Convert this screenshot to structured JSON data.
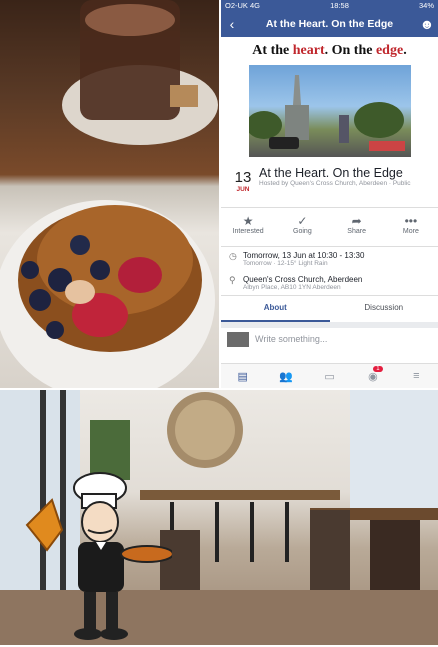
{
  "status": {
    "carrier": "O2-UK 4G",
    "time": "18:58",
    "battery": "34%"
  },
  "nav": {
    "back_icon": "back-chevron-icon",
    "title": "At the Heart. On the Edge",
    "profile_icon": "profile-icon"
  },
  "cover": {
    "head_pre": "At the ",
    "head_red1": "heart",
    "head_mid": ". On the ",
    "head_red2": "edge",
    "head_post": "."
  },
  "event": {
    "day": "13",
    "month": "JUN",
    "title": "At the Heart. On the Edge",
    "host": "Hosted by Queen's Cross Church, Aberdeen · Public"
  },
  "actions": [
    {
      "icon": "★",
      "label": "Interested"
    },
    {
      "icon": "✓",
      "label": "Going"
    },
    {
      "icon": "➦",
      "label": "Share"
    },
    {
      "icon": "•••",
      "label": "More"
    }
  ],
  "details": {
    "time": "Tomorrow, 13 Jun at 10:30 - 13:30",
    "weather": "Tomorrow · 12-15° Light Rain",
    "place": "Queen's Cross Church, Aberdeen",
    "address": "Albyn Place, AB10 1YN Aberdeen"
  },
  "tabs": {
    "about": "About",
    "discussion": "Discussion"
  },
  "composer": {
    "placeholder": "Write something..."
  },
  "tabbar": {
    "badge": "1"
  },
  "colors": {
    "facebook_blue": "#3b5998",
    "accent_red": "#c0272d"
  }
}
